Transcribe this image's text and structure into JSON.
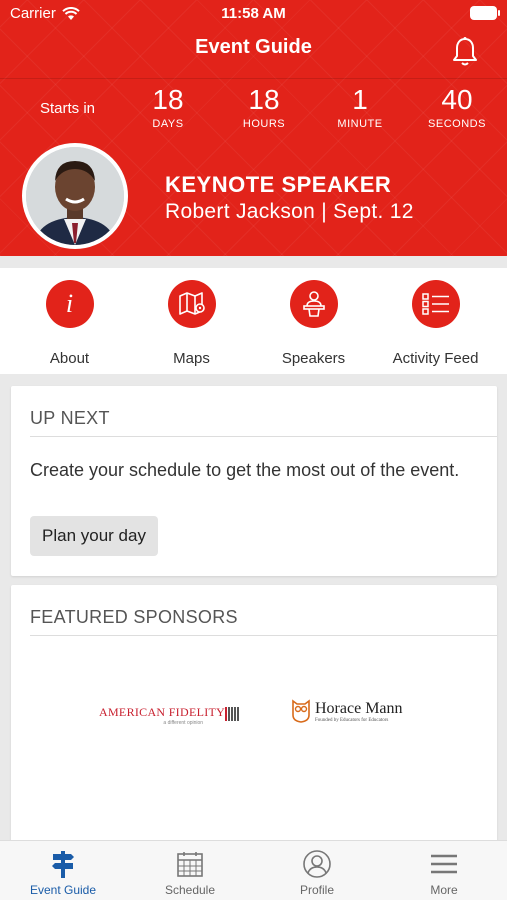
{
  "status_bar": {
    "carrier": "Carrier",
    "time": "11:58 AM"
  },
  "header": {
    "title": "Event Guide"
  },
  "countdown": {
    "starts_in": "Starts in",
    "days": {
      "value": "18",
      "label": "DAYS"
    },
    "hours": {
      "value": "18",
      "label": "HOURS"
    },
    "minutes": {
      "value": "1",
      "label": "MINUTE"
    },
    "seconds": {
      "value": "40",
      "label": "SECONDS"
    }
  },
  "keynote": {
    "title": "KEYNOTE SPEAKER",
    "subtitle": "Robert Jackson | Sept. 12"
  },
  "quick_links": [
    {
      "label": "About",
      "icon": "info-icon"
    },
    {
      "label": "Maps",
      "icon": "map-icon"
    },
    {
      "label": "Speakers",
      "icon": "speaker-icon"
    },
    {
      "label": "Activity Feed",
      "icon": "activity-feed-icon"
    }
  ],
  "up_next": {
    "title": "UP NEXT",
    "text": "Create your schedule to get the most out of the event.",
    "button": "Plan your day"
  },
  "sponsors": {
    "title": "FEATURED SPONSORS",
    "items": [
      {
        "name": "AMERICAN FIDELITY",
        "tagline": "a different opinion"
      },
      {
        "name": "Horace Mann",
        "tagline": "Founded by Educators for Educators"
      }
    ]
  },
  "tabs": [
    {
      "label": "Event Guide",
      "icon": "signpost-icon",
      "active": true
    },
    {
      "label": "Schedule",
      "icon": "calendar-icon",
      "active": false
    },
    {
      "label": "Profile",
      "icon": "profile-icon",
      "active": false
    },
    {
      "label": "More",
      "icon": "menu-icon",
      "active": false
    }
  ],
  "colors": {
    "brand_red": "#e2231a",
    "active_tab": "#1a5ca8"
  }
}
